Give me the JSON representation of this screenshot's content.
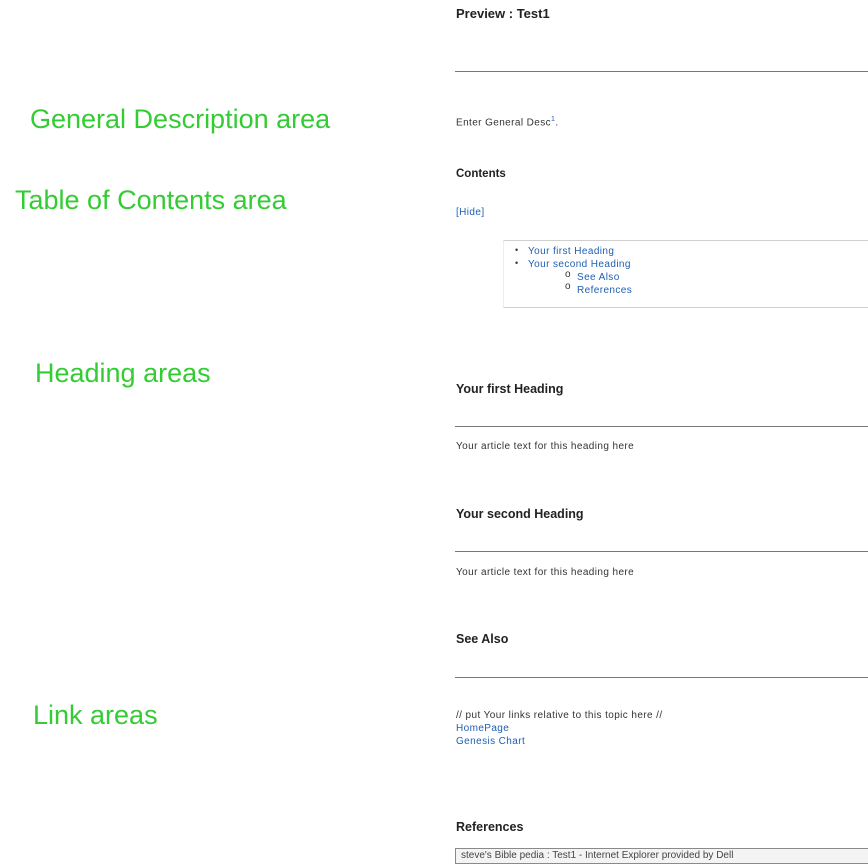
{
  "annotations": {
    "general": "General Description area",
    "toc": "Table of Contents area",
    "headings": "Heading areas",
    "links": "Link areas"
  },
  "preview": {
    "title": "Preview : Test1",
    "general_desc": "Enter General Desc",
    "general_desc_sup": "1",
    "general_desc_end": ".",
    "contents_title": "Contents",
    "hide_link": "[Hide]",
    "toc": {
      "items": [
        {
          "label": "Your first Heading"
        },
        {
          "label": "Your second Heading"
        }
      ],
      "subitems": [
        {
          "label": "See Also"
        },
        {
          "label": "References"
        }
      ]
    },
    "sections": [
      {
        "heading": "Your first Heading",
        "text": "Your article text for this heading here"
      },
      {
        "heading": "Your second Heading",
        "text": "Your article text for this heading here"
      }
    ],
    "see_also": {
      "heading": "See Also",
      "note": "// put Your links relative to this topic here //",
      "links": [
        "HomePage",
        "Genesis Chart"
      ]
    },
    "references_heading": "References"
  },
  "statusbar": {
    "title": "steve's Bible pedia : Test1 - Internet Explorer provided by Dell"
  },
  "colors": {
    "annotation": "#33cc33",
    "link": "#1e5fb3"
  }
}
